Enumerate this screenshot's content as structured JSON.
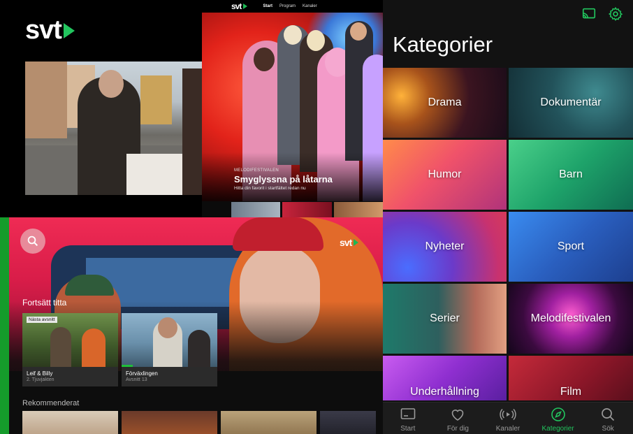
{
  "brand": {
    "logo_text": "svt",
    "accent": "#22c55e"
  },
  "web": {
    "logo_text": "svt",
    "nav": [
      "Start",
      "Program",
      "Kanaler"
    ],
    "hero": {
      "kicker": "MELODIFESTIVALEN",
      "title": "Smyglyssna på låtarna",
      "description": "Hitta din favorit i startfältet redan nu"
    }
  },
  "phone": {
    "title": "Kategorier",
    "icons": {
      "cast": "cast-icon",
      "settings": "gear-icon"
    },
    "categories": [
      "Drama",
      "Dokumentär",
      "Humor",
      "Barn",
      "Nyheter",
      "Sport",
      "Serier",
      "Melodifestivalen",
      "Underhållning",
      "Film"
    ],
    "tabs": [
      "Start",
      "För dig",
      "Kanaler",
      "Kategorier",
      "Sök"
    ],
    "active_tab": "Kategorier",
    "accent": "#22c55e"
  },
  "tv": {
    "logo_text": "svt",
    "continue_label": "Fortsätt titta",
    "cards": [
      {
        "badge": "Nästa avsnitt",
        "title": "Leif & Billy",
        "subtitle": "2. Tjuvjakten"
      },
      {
        "title": "Förväxlingen",
        "subtitle": "Avsnitt 13",
        "progress": 0.12
      }
    ],
    "recommended_label": "Rekommenderat"
  }
}
